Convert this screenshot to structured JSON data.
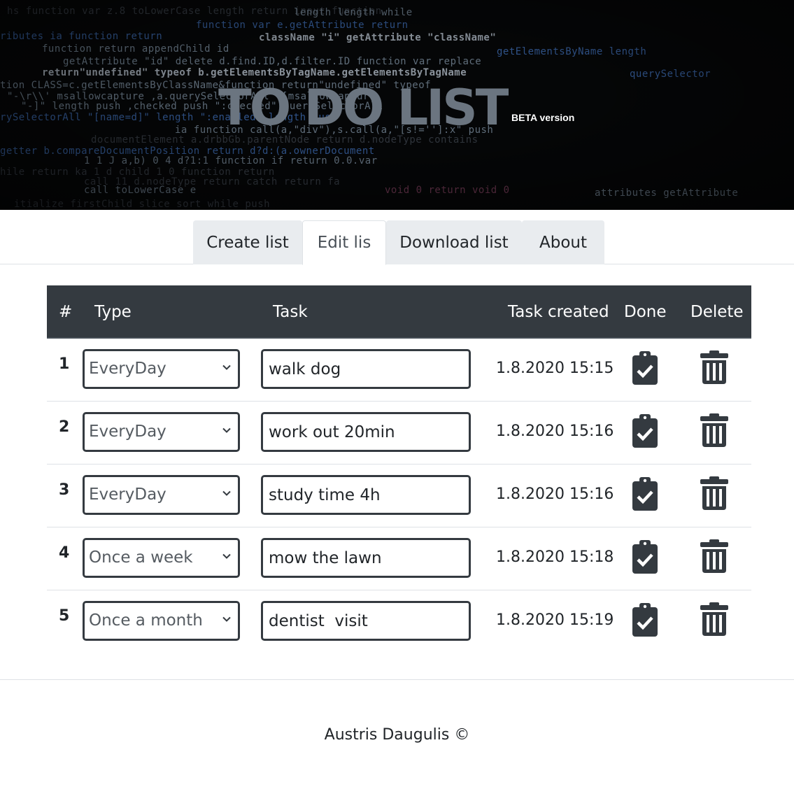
{
  "hero": {
    "title": "TO DO LIST",
    "badge": "BETA version"
  },
  "tabs": [
    {
      "label": "Create list",
      "active": false
    },
    {
      "label": "Edit lis",
      "active": true
    },
    {
      "label": "Download list",
      "active": false
    },
    {
      "label": "About",
      "active": false
    }
  ],
  "table": {
    "headers": {
      "num": "#",
      "type": "Type",
      "task": "Task",
      "created": "Task created",
      "done": "Done",
      "delete": "Delete"
    },
    "rows": [
      {
        "num": "1",
        "type": "EveryDay",
        "task": "walk dog",
        "created": "1.8.2020 15:15"
      },
      {
        "num": "2",
        "type": "EveryDay",
        "task": "work out 20min",
        "created": "1.8.2020 15:16"
      },
      {
        "num": "3",
        "type": "EveryDay",
        "task": "study time 4h",
        "created": "1.8.2020 15:16"
      },
      {
        "num": "4",
        "type": "Once a week",
        "task": "mow the lawn",
        "created": "1.8.2020 15:18"
      },
      {
        "num": "5",
        "type": "Once a month",
        "task": "dentist  visit",
        "created": "1.8.2020 15:19"
      }
    ],
    "icons": {
      "done": "clipboard-check-icon",
      "delete": "trash-icon"
    }
  },
  "footer": {
    "text": "Austris Daugulis ©"
  },
  "colors": {
    "header_bg": "#343a40",
    "tab_bg": "#e9ecef",
    "icon": "#343a40",
    "hero_bg": "#050607"
  }
}
